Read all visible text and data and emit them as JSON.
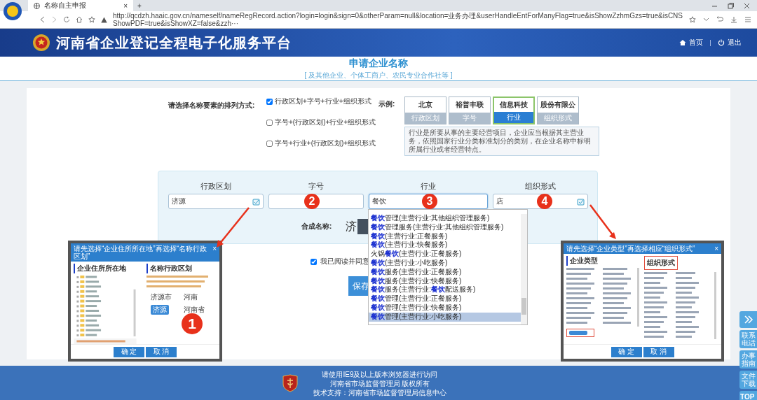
{
  "browser": {
    "tab_title": "名称自主申报",
    "tab_close": "×",
    "new_tab": "+",
    "address": "http://qcdzh.haaic.gov.cn/nameself/nameRegRecord.action?login=login&sign=0&otherParam=null&location=业务办理&userHandleEntForManyFlag=true&isShowZzhmGzs=true&isCNSShowPDF=true&isShowXZ=false&zzh···"
  },
  "header": {
    "title": "河南省企业登记全程电子化服务平台",
    "nav": [
      {
        "kind": "home",
        "label": "首页"
      },
      {
        "kind": "logout",
        "label": "退出"
      }
    ]
  },
  "page_heading": {
    "title": "申请企业名称",
    "subtitle": "[ 及其他企业、个体工商户、农民专业合作社等 ]"
  },
  "order": {
    "label": "请选择名称要素的排列方式:",
    "options": [
      {
        "label": "行政区划+字号+行业+组织形式",
        "checked": true
      },
      {
        "label": "字号+(行政区划)+行业+组织形式",
        "checked": false
      },
      {
        "label": "字号+行业+(行政区划)+组织形式",
        "checked": false
      }
    ]
  },
  "example": {
    "label": "示例:",
    "items": [
      {
        "sample": "北京",
        "label": "行政区划",
        "selected": false
      },
      {
        "sample": "裕普丰联",
        "label": "字号",
        "selected": false
      },
      {
        "sample": "信息科技",
        "label": "行业",
        "selected": true
      },
      {
        "sample": "股份有限公",
        "label": "组织形式",
        "selected": false
      }
    ],
    "hint": "行业是所要从事的主要经营项目，企业应当根据其主营业务，依照国家行业分类标准划分的类别，在企业名称中标明所属行业或者经营特点。"
  },
  "fields": [
    {
      "label": "行政区划",
      "kind": "picker",
      "value": "济源"
    },
    {
      "label": "字号",
      "kind": "text",
      "step": "2"
    },
    {
      "label": "行业",
      "kind": "text",
      "value": "餐饮",
      "step": "3"
    },
    {
      "label": "组织形式",
      "kind": "picker",
      "value": "店",
      "step": "4"
    }
  ],
  "suggestions": [
    {
      "text": "**餐饮**管理(主营行业:其他组织管理服务)",
      "selected": false
    },
    {
      "text": "**餐饮**管理服务(主营行业:其他组织管理服务)",
      "selected": false
    },
    {
      "text": "**餐饮**(主营行业:正餐服务)",
      "selected": false
    },
    {
      "text": "**餐饮**(主营行业:快餐服务)",
      "selected": false
    },
    {
      "text": "火锅**餐饮**(主营行业:正餐服务)",
      "selected": false
    },
    {
      "text": "**餐饮**(主营行业:小吃服务)",
      "selected": false
    },
    {
      "text": "**餐饮**服务(主营行业:正餐服务)",
      "selected": false
    },
    {
      "text": "**餐饮**服务(主营行业:快餐服务)",
      "selected": false
    },
    {
      "text": "**餐饮**服务(主营行业:**餐饮**配送服务)",
      "selected": false
    },
    {
      "text": "**餐饮**管理(主营行业:正餐服务)",
      "selected": false
    },
    {
      "text": "**餐饮**管理(主营行业:快餐服务)",
      "selected": false
    },
    {
      "text": "**餐饮**管理(主营行业:小吃服务)",
      "selected": true
    }
  ],
  "composed": {
    "label": "合成名称:",
    "value": "济"
  },
  "agreement": {
    "label": "我已阅读并同意",
    "checked": true
  },
  "save_button": "保存",
  "region_popup": {
    "title": "请先选择“企业住所所在地”再选择“名称行政区划”",
    "close": "×",
    "left_heading": "企业住所所在地",
    "right_heading": "名称行政区划",
    "rows": [
      {
        "cells": [
          "济源市",
          "河南"
        ],
        "selected": false
      },
      {
        "cells": [
          "济源",
          "河南省"
        ],
        "selected": true
      }
    ],
    "step": "1",
    "buttons": [
      "确 定",
      "取 消"
    ]
  },
  "form_popup": {
    "title": "请先选择“企业类型”再选择相应“组织形式”",
    "close": "×",
    "left_heading": "企业类型",
    "right_heading": "组织形式",
    "buttons": [
      "确 定",
      "取 消"
    ]
  },
  "side_tools": [
    "联系电话",
    "办事指南",
    "文件下载",
    "TOP"
  ],
  "footer": {
    "lines": [
      "请使用IE9及以上版本浏览器进行访问",
      "河南省市场监督管理局 版权所有",
      "技术支持：河南省市场监督管理局信息中心"
    ]
  }
}
